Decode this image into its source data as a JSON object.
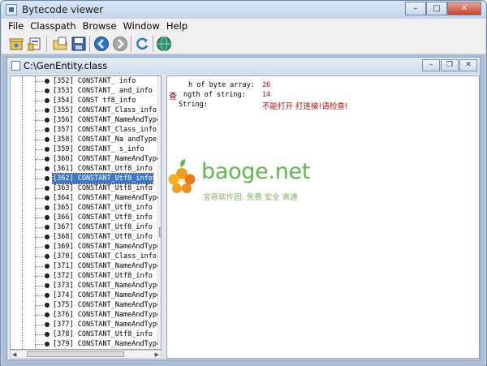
{
  "window": {
    "title": "Bytecode viewer",
    "minimize": "–",
    "maximize": "□",
    "close": "✕"
  },
  "menu": [
    "File",
    "Classpath",
    "Browse",
    "Window",
    "Help"
  ],
  "toolbar": [
    {
      "icon": "open-jar-icon"
    },
    {
      "icon": "open-class-icon"
    },
    {
      "icon": "open-folder-icon"
    },
    {
      "icon": "save-icon"
    },
    {
      "icon": "back-arrow-icon"
    },
    {
      "icon": "forward-arrow-icon"
    },
    {
      "icon": "refresh-icon"
    },
    {
      "icon": "globe-icon"
    }
  ],
  "child_window": {
    "title": "C:\\GenEntity.class",
    "minimize": "–",
    "restore": "❐",
    "close": "✕"
  },
  "tree": {
    "items": [
      "[352] CONSTANT_  info",
      "[353] CONSTANT_  and_info",
      "[354] CONST  tf8_info",
      "[355] CONSTANT_Class_info",
      "[356] CONSTANT_NameAndType_in",
      "[357] CONSTANT_Class_info",
      "[358] CONSTANT_Na  andType_in",
      "[359] CONSTANT_  s_info",
      "[360] CONSTANT_NameAndType_in",
      "[361] CONSTANT_Utf8_info",
      "[362] CONSTANT_Utf8_info",
      "[363] CONSTANT_Utf8_info",
      "[364] CONSTANT_NameAndType_in",
      "[365] CONSTANT_Utf8_info",
      "[366] CONSTANT_Utf8_info",
      "[367] CONSTANT_Utf8_info",
      "[368] CONSTANT_Utf8_info",
      "[369] CONSTANT_NameAndType_in",
      "[370] CONSTANT_Class_info",
      "[371] CONSTANT_NameAndType_in",
      "[372] CONSTANT_Utf8_info",
      "[373] CONSTANT_NameAndType_in",
      "[374] CONSTANT_NameAndType_in",
      "[375] CONSTANT_NameAndType_in",
      "[376] CONSTANT_NameAndType_in",
      "[377] CONSTANT_NameAndType_in",
      "[378] CONSTANT_Utf8_info",
      "[379] CONSTANT_NameAndType_in"
    ],
    "selected_index": 10
  },
  "detail": {
    "label1": "h of byte array:",
    "value1": "26",
    "label2": "ngth of string:",
    "value2": "14",
    "label3": "String:",
    "value3": "不能打开  打连接!请检查!",
    "overlay_glyph": "查"
  },
  "watermark": {
    "brand": "baoge.net",
    "tagline": "宝哥软件园: 免费 安全 高速"
  },
  "colors": {
    "selection": "#3a78c9",
    "value_red": "#c00000",
    "watermark_green": "#5fb84a"
  }
}
